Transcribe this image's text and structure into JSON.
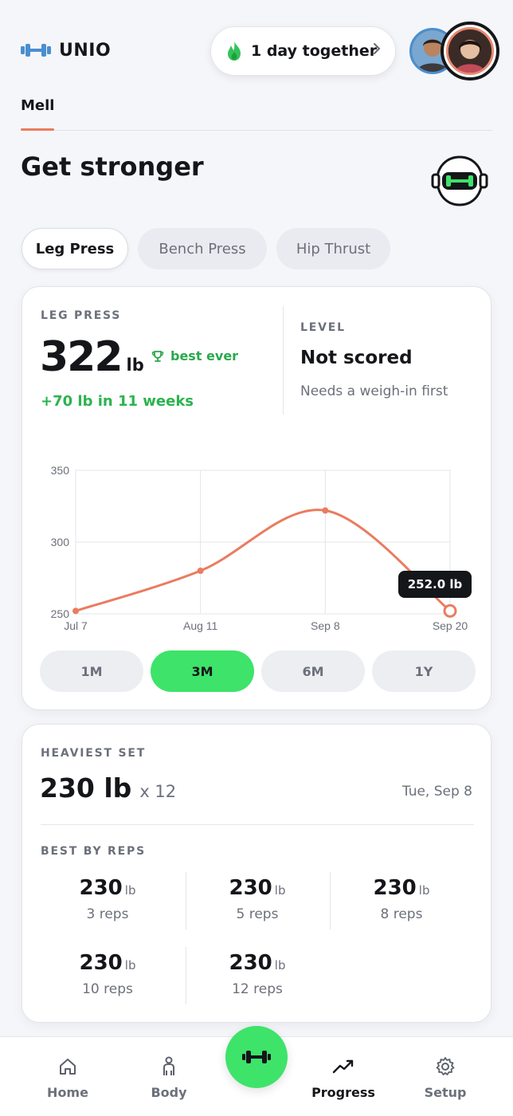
{
  "header": {
    "brand": "UNIO",
    "streak_text": "1 day together",
    "tab_label": "Mell"
  },
  "page": {
    "title": "Get stronger"
  },
  "exercise_tabs": [
    {
      "label": "Leg Press",
      "active": true
    },
    {
      "label": "Bench Press",
      "active": false
    },
    {
      "label": "Hip Thrust",
      "active": false
    }
  ],
  "summary": {
    "label": "LEG PRESS",
    "value": "322",
    "unit": "lb",
    "badge": "best ever",
    "gain": "+70 lb in 11 weeks",
    "level_label": "LEVEL",
    "level_value": "Not scored",
    "level_sub": "Needs a weigh-in first"
  },
  "chart_data": {
    "type": "line",
    "x": [
      "Jul 7",
      "Aug 11",
      "Sep 8",
      "Sep 20"
    ],
    "values": [
      252,
      280,
      322,
      252
    ],
    "yticks": [
      250,
      300,
      350
    ],
    "ylim": [
      250,
      350
    ],
    "tooltip": "252.0 lb",
    "color": "#ea7c5f"
  },
  "ranges": [
    {
      "label": "1M",
      "active": false
    },
    {
      "label": "3M",
      "active": true
    },
    {
      "label": "6M",
      "active": false
    },
    {
      "label": "1Y",
      "active": false
    }
  ],
  "heaviest": {
    "label": "HEAVIEST SET",
    "value": "230 lb",
    "reps": "x 12",
    "date": "Tue, Sep 8"
  },
  "best_by_reps": {
    "label": "BEST BY REPS",
    "items": [
      {
        "value": "230",
        "unit": "lb",
        "reps": "3 reps"
      },
      {
        "value": "230",
        "unit": "lb",
        "reps": "5 reps"
      },
      {
        "value": "230",
        "unit": "lb",
        "reps": "8 reps"
      },
      {
        "value": "230",
        "unit": "lb",
        "reps": "10 reps"
      },
      {
        "value": "230",
        "unit": "lb",
        "reps": "12 reps"
      }
    ]
  },
  "nav": [
    {
      "label": "Home",
      "icon": "home-icon"
    },
    {
      "label": "Body",
      "icon": "body-icon"
    },
    {
      "label": "Progress",
      "icon": "trend-icon",
      "active": true
    },
    {
      "label": "Setup",
      "icon": "gear-icon"
    }
  ],
  "colors": {
    "accent_green": "#3ee36a",
    "accent_orange": "#ea7c5f",
    "gain_green": "#2bb34f"
  }
}
